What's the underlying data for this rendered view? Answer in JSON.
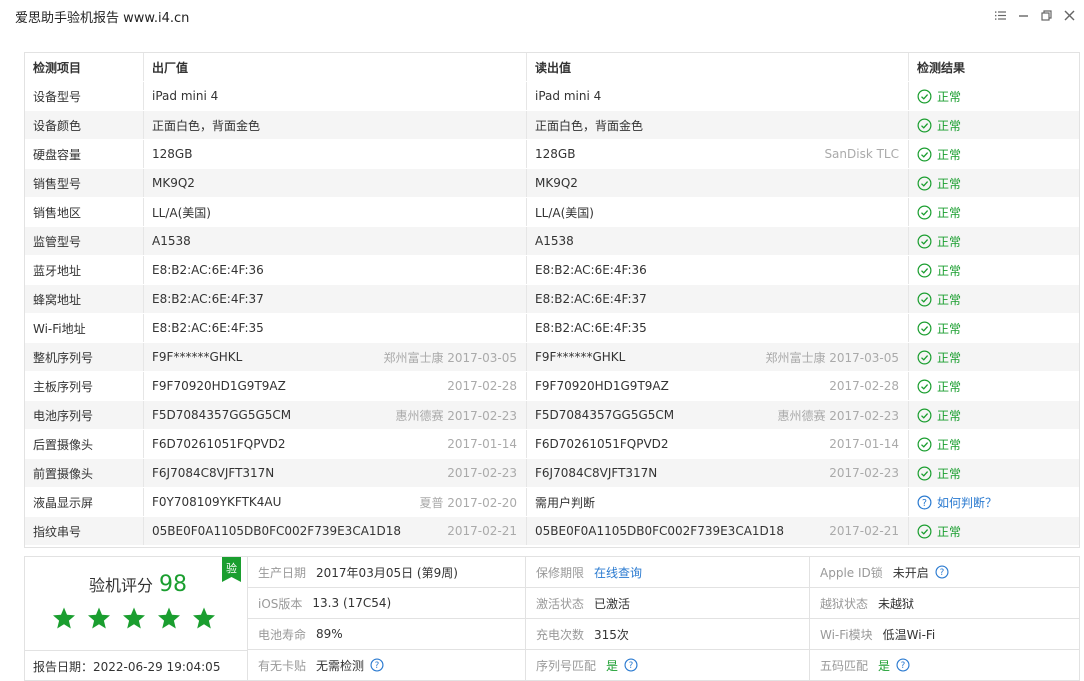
{
  "window": {
    "title": "爱思助手验机报告 www.i4.cn"
  },
  "table": {
    "headers": [
      "检测项目",
      "出厂值",
      "读出值",
      "检测结果"
    ],
    "rows": [
      {
        "item": "设备型号",
        "factory": "iPad mini 4",
        "factory_note": "",
        "read": "iPad mini 4",
        "read_note": "",
        "result": "正常",
        "status": "ok"
      },
      {
        "item": "设备颜色",
        "factory": "正面白色，背面金色",
        "factory_note": "",
        "read": "正面白色，背面金色",
        "read_note": "",
        "result": "正常",
        "status": "ok"
      },
      {
        "item": "硬盘容量",
        "factory": "128GB",
        "factory_note": "",
        "read": "128GB",
        "read_note": "SanDisk TLC",
        "result": "正常",
        "status": "ok"
      },
      {
        "item": "销售型号",
        "factory": "MK9Q2",
        "factory_note": "",
        "read": "MK9Q2",
        "read_note": "",
        "result": "正常",
        "status": "ok"
      },
      {
        "item": "销售地区",
        "factory": "LL/A(美国)",
        "factory_note": "",
        "read": "LL/A(美国)",
        "read_note": "",
        "result": "正常",
        "status": "ok"
      },
      {
        "item": "监管型号",
        "factory": "A1538",
        "factory_note": "",
        "read": "A1538",
        "read_note": "",
        "result": "正常",
        "status": "ok"
      },
      {
        "item": "蓝牙地址",
        "factory": "E8:B2:AC:6E:4F:36",
        "factory_note": "",
        "read": "E8:B2:AC:6E:4F:36",
        "read_note": "",
        "result": "正常",
        "status": "ok"
      },
      {
        "item": "蜂窝地址",
        "factory": "E8:B2:AC:6E:4F:37",
        "factory_note": "",
        "read": "E8:B2:AC:6E:4F:37",
        "read_note": "",
        "result": "正常",
        "status": "ok"
      },
      {
        "item": "Wi-Fi地址",
        "factory": "E8:B2:AC:6E:4F:35",
        "factory_note": "",
        "read": "E8:B2:AC:6E:4F:35",
        "read_note": "",
        "result": "正常",
        "status": "ok"
      },
      {
        "item": "整机序列号",
        "factory": "F9F******GHKL",
        "factory_note": "郑州富士康 2017-03-05",
        "read": "F9F******GHKL",
        "read_note": "郑州富士康 2017-03-05",
        "result": "正常",
        "status": "ok"
      },
      {
        "item": "主板序列号",
        "factory": "F9F70920HD1G9T9AZ",
        "factory_note": "2017-02-28",
        "read": "F9F70920HD1G9T9AZ",
        "read_note": "2017-02-28",
        "result": "正常",
        "status": "ok"
      },
      {
        "item": "电池序列号",
        "factory": "F5D7084357GG5G5CM",
        "factory_note": "惠州德赛 2017-02-23",
        "read": "F5D7084357GG5G5CM",
        "read_note": "惠州德赛 2017-02-23",
        "result": "正常",
        "status": "ok"
      },
      {
        "item": "后置摄像头",
        "factory": "F6D70261051FQPVD2",
        "factory_note": "2017-01-14",
        "read": "F6D70261051FQPVD2",
        "read_note": "2017-01-14",
        "result": "正常",
        "status": "ok"
      },
      {
        "item": "前置摄像头",
        "factory": "F6J7084C8VJFT317N",
        "factory_note": "2017-02-23",
        "read": "F6J7084C8VJFT317N",
        "read_note": "2017-02-23",
        "result": "正常",
        "status": "ok"
      },
      {
        "item": "液晶显示屏",
        "factory": "F0Y708109YKFTK4AU",
        "factory_note": "夏普 2017-02-20",
        "read": "需用户判断",
        "read_note": "",
        "result": "如何判断？",
        "status": "question"
      },
      {
        "item": "指纹串号",
        "factory": "05BE0F0A1105DB0FC002F739E3CA1D18",
        "factory_note": "2017-02-21",
        "read": "05BE0F0A1105DB0FC002F739E3CA1D18",
        "read_note": "2017-02-21",
        "result": "正常",
        "status": "ok"
      }
    ]
  },
  "score": {
    "label": "验机评分",
    "value": "98",
    "badge": "验",
    "stars": 5,
    "report_date": "报告日期：2022-06-29 19:04:05"
  },
  "info": {
    "rows": [
      [
        {
          "key": "生产日期",
          "value": "2017年03月05日 (第9周)",
          "style": "normal",
          "help": false
        },
        {
          "key": "保修期限",
          "value": "在线查询",
          "style": "link",
          "help": false
        },
        {
          "key": "Apple ID锁",
          "value": "未开启",
          "style": "normal",
          "help": true
        }
      ],
      [
        {
          "key": "iOS版本",
          "value": "13.3 (17C54)",
          "style": "normal",
          "help": false
        },
        {
          "key": "激活状态",
          "value": "已激活",
          "style": "normal",
          "help": false
        },
        {
          "key": "越狱状态",
          "value": "未越狱",
          "style": "normal",
          "help": false
        }
      ],
      [
        {
          "key": "电池寿命",
          "value": "89%",
          "style": "normal",
          "help": false
        },
        {
          "key": "充电次数",
          "value": "315次",
          "style": "normal",
          "help": false
        },
        {
          "key": "Wi-Fi模块",
          "value": "低温Wi-Fi",
          "style": "normal",
          "help": false
        }
      ],
      [
        {
          "key": "有无卡贴",
          "value": "无需检测",
          "style": "normal",
          "help": true
        },
        {
          "key": "序列号匹配",
          "value": "是",
          "style": "green",
          "help": true
        },
        {
          "key": "五码匹配",
          "value": "是",
          "style": "green",
          "help": true
        }
      ]
    ]
  },
  "colors": {
    "ok": "#1a9e2f",
    "link": "#2a7ad0",
    "muted": "#aaaaaa"
  },
  "icons": {
    "window_controls": [
      "list-icon",
      "minimize-icon",
      "restore-icon",
      "close-icon"
    ],
    "ok": "check-circle-icon",
    "question": "question-circle-icon",
    "star": "star-icon"
  }
}
